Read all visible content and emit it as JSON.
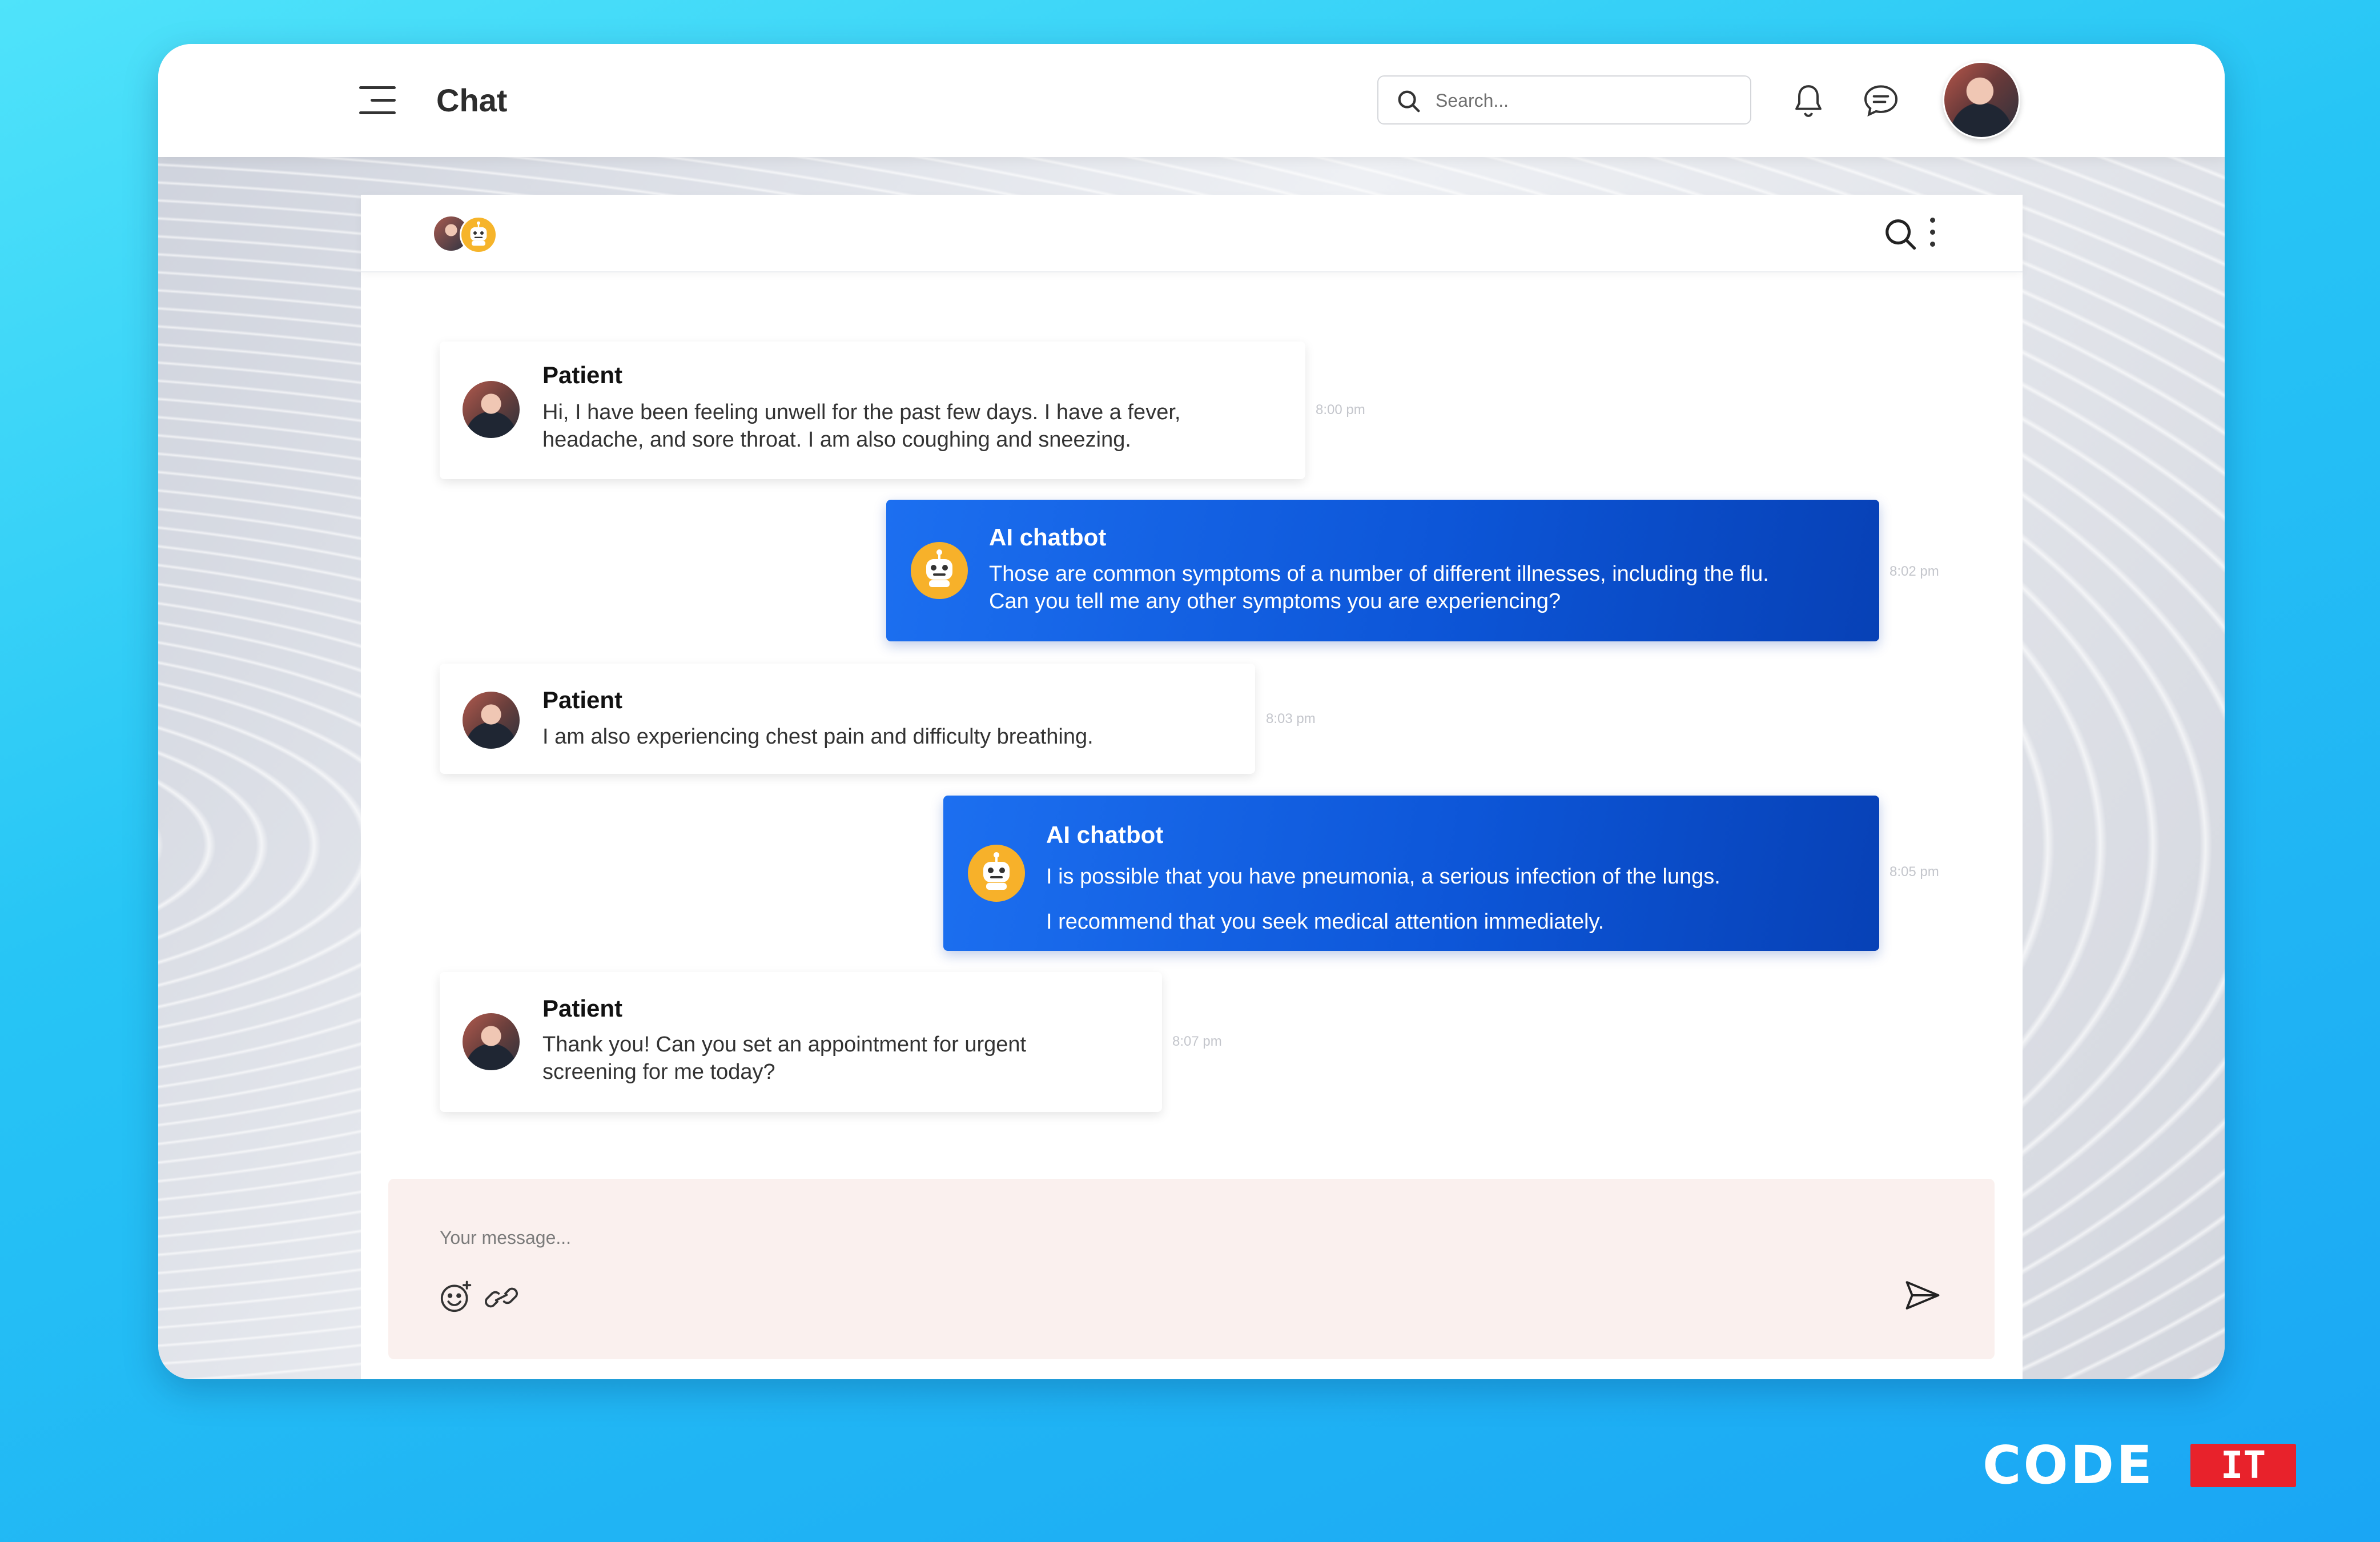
{
  "topbar": {
    "title": "Chat",
    "search_placeholder": "Search...",
    "icons": [
      "menu-icon",
      "search-icon",
      "bell-icon",
      "chat-bubble-icon",
      "user-avatar"
    ]
  },
  "chat_header": {
    "icons": [
      "search-icon",
      "more-vertical-icon"
    ]
  },
  "messages": [
    {
      "sender": "Patient",
      "lines": [
        "Hi, I have been feeling unwell for the past few days. I have a fever,",
        "headache, and sore throat. I am also coughing and sneezing."
      ],
      "time": "8:00 pm"
    },
    {
      "sender": "AI chatbot",
      "lines": [
        "Those are common symptoms of a number of different illnesses, including the flu.",
        "Can you tell me any other symptoms you are experiencing?"
      ],
      "time": "8:02 pm"
    },
    {
      "sender": "Patient",
      "lines": [
        "I am also experiencing chest pain and difficulty breathing."
      ],
      "time": "8:03 pm"
    },
    {
      "sender": "AI chatbot",
      "lines": [
        "I is possible that you have pneumonia, a serious infection of the lungs.",
        "I recommend that you seek medical attention immediately."
      ],
      "time": "8:05 pm"
    },
    {
      "sender": "Patient",
      "lines": [
        "Thank you! Can you set an appointment for urgent",
        "screening for me today?"
      ],
      "time": "8:07 pm"
    }
  ],
  "composer": {
    "placeholder": "Your message...",
    "icons": [
      "emoji-add-icon",
      "link-icon",
      "send-icon"
    ]
  },
  "brand": {
    "part1": "CODE",
    "part2": "IT"
  },
  "colors": {
    "bot_bubble": "#0d56d8",
    "bot_avatar": "#f7b12a",
    "brand_red": "#e8222b",
    "background": "#27c5f5"
  }
}
